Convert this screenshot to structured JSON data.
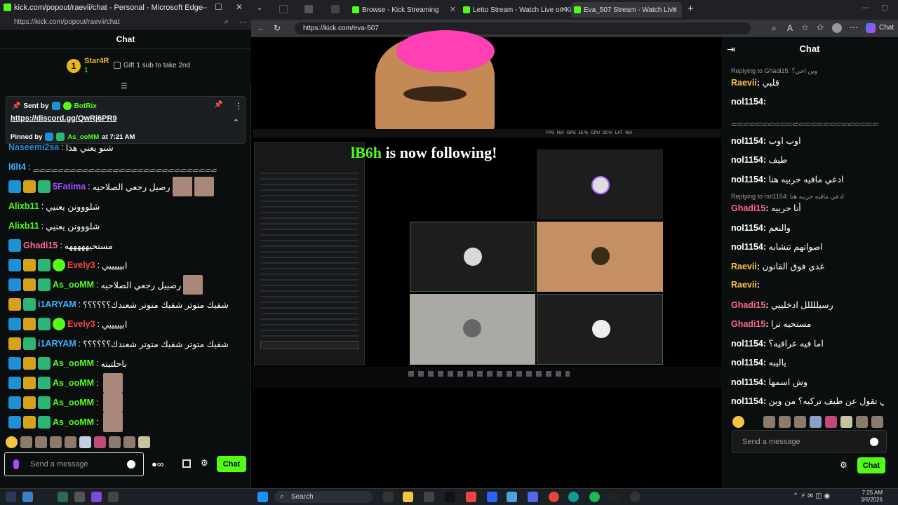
{
  "left_window": {
    "title": "kick.com/popout/raevii/chat - Personal - Microsoft Edge",
    "url": "https://kick.com/popout/raevii/chat",
    "chat_header": "Chat",
    "leader": {
      "rank": "1",
      "name": "Star4R",
      "count": "1",
      "gift_text": "Gift 1 sub to take 2nd"
    },
    "pinned": {
      "sent_by": "Sent by",
      "sender": "BotRix",
      "link": "https://discord.gg/QwRj6PR9",
      "pinned_by": "Pinned by",
      "pinner": "As_ooMM",
      "time": "at 7:21 AM"
    },
    "messages": [
      {
        "user": "Naseemi2sa",
        "text": "شنو يعني هذا",
        "color": "#1f8fd6"
      },
      {
        "user": "l6lt4",
        "text": "ﮯﮯﮯﮯﮯﮯﮯﮯﮯﮯﮯﮯﮯﮯﮯﮯﮯﮯﮯﮯﮯﮯﮯﮯﮯﮯﮯﮯﮯﮯ",
        "color": "#3cb3ff"
      },
      {
        "user": "5Fatima",
        "text": "رصيل رجعي الصلاحيه",
        "color": "#a54cff"
      },
      {
        "user": "Alixb11",
        "text": "شلووونن يعنيي",
        "color": "#53fc18"
      },
      {
        "user": "Alixb11",
        "text": "شلووونن يعنيي",
        "color": "#53fc18"
      },
      {
        "user": "Ghadi15",
        "text": "مستحيهههههه",
        "color": "#ff6b8a"
      },
      {
        "user": "Evely3",
        "text": "ابيييييي",
        "color": "#ff4242"
      },
      {
        "user": "As_ooMM",
        "text": "رصييل رجعي الصلاحيه",
        "color": "#53fc18"
      },
      {
        "user": "i1ARYAM",
        "text": "شفيك متوتر شفيك متوتر شعندك؟؟؟؟؟؟",
        "color": "#3cb3ff"
      },
      {
        "user": "Evely3",
        "text": "ابيييييي",
        "color": "#ff4242"
      },
      {
        "user": "i1ARYAM",
        "text": "شفيك متوتر شفيك متوتر شعندك؟؟؟؟؟؟",
        "color": "#3cb3ff"
      },
      {
        "user": "As_ooMM",
        "text": "باحلتيته",
        "color": "#53fc18"
      },
      {
        "user": "As_ooMM",
        "text": "",
        "color": "#53fc18"
      },
      {
        "user": "As_ooMM",
        "text": "",
        "color": "#53fc18"
      },
      {
        "user": "As_ooMM",
        "text": "",
        "color": "#53fc18"
      }
    ],
    "input_placeholder": "Send a message",
    "chat_button": "Chat"
  },
  "browser": {
    "tabs": [
      {
        "label": "Browse - Kick Streaming"
      },
      {
        "label": "Letto Stream - Watch Live on Kick"
      },
      {
        "label": "Eva_507 Stream - Watch Live"
      }
    ],
    "url": "https://kick.com/eva-507"
  },
  "stream": {
    "follow_user": "lB6h",
    "follow_text": "is now following!",
    "overlay": {
      "fps": "FPS",
      "fps_val": "N/A",
      "gpu": "GPU",
      "gpu_val": "15 %",
      "cpu": "CPU",
      "cpu_val": "20 %",
      "lat": "LAT",
      "lat_val": "N/A"
    }
  },
  "right_chat": {
    "header": "Chat",
    "messages": [
      {
        "reply": "Replying to Ghadi15: وين اخي؟",
        "user": "Raevii",
        "text": "قلبي",
        "color": "#f5c542"
      },
      {
        "user": "nol1154",
        "text": "",
        "color": "#ffffff"
      },
      {
        "user": "",
        "text": "ﮯﮯﮯﮯﮯﮯﮯﮯﮯﮯﮯﮯﮯﮯﮯﮯﮯﮯﮯﮯﮯﮯﮯﮯ",
        "color": "#ffffff"
      },
      {
        "user": "nol1154",
        "text": "اوب اوب",
        "color": "#ffffff"
      },
      {
        "user": "nol1154",
        "text": "طيف",
        "color": "#ffffff"
      },
      {
        "user": "nol1154",
        "text": "ادعي مافيه حربيه هنا",
        "color": "#ffffff"
      },
      {
        "reply": "Replying to nol1154: ادعي مافيه حربيه هنا",
        "user": "Ghadi15",
        "text": "أنا حربيه",
        "color": "#ff6b8a"
      },
      {
        "user": "nol1154",
        "text": "والنعم",
        "color": "#ffffff"
      },
      {
        "user": "nol1154",
        "text": "اصواتهم تتشابه",
        "color": "#ffffff"
      },
      {
        "user": "Raevii",
        "text": "غدي فوق القانون",
        "color": "#f5c542"
      },
      {
        "user": "Raevii",
        "text": "",
        "color": "#f5c542"
      },
      {
        "user": "Ghadi15",
        "text": "رسيللللل ادخلييي",
        "color": "#ff6b8a"
      },
      {
        "user": "Ghadi15",
        "text": "مستحيه ترا",
        "color": "#ff6b8a"
      },
      {
        "user": "nol1154",
        "text": "اما فيه عراقيه؟",
        "color": "#ffffff"
      },
      {
        "user": "nol1154",
        "text": "ياليبه",
        "color": "#ffffff"
      },
      {
        "user": "nol1154",
        "text": "وش اسمها",
        "color": "#ffffff"
      },
      {
        "user": "nol1154",
        "text": "الي تقول عن طيف تركيه؟ من وين",
        "color": "#ffffff"
      }
    ],
    "input_placeholder": "Send a message",
    "chat_button": "Chat"
  },
  "taskbar": {
    "search": "Search",
    "time": "7:25 AM",
    "date": "3/6/2026"
  },
  "colors": {
    "kick_green": "#53fc18",
    "bg": "#0b0e0f"
  }
}
